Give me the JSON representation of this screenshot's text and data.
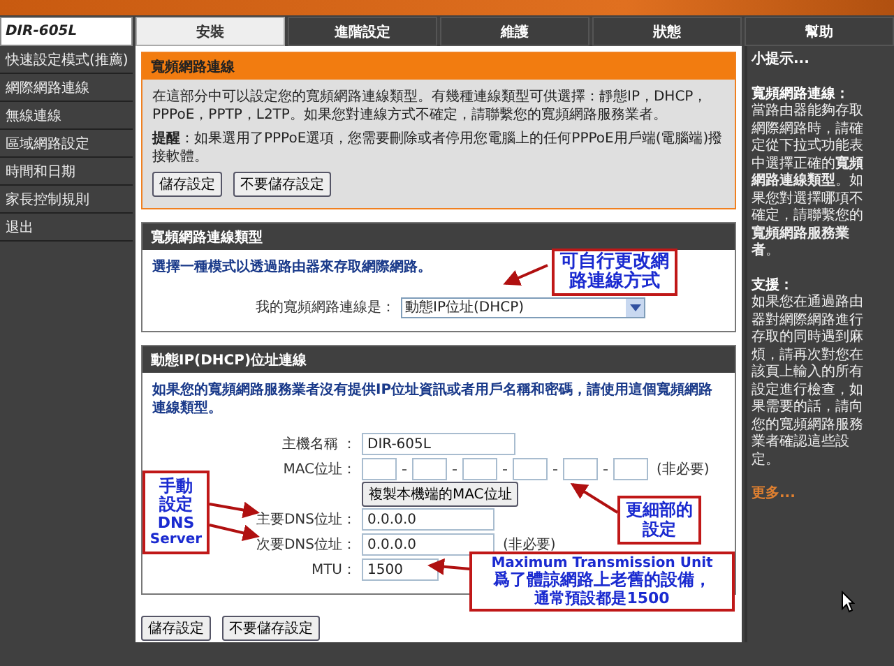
{
  "logo": "DIR-605L",
  "tabs": [
    {
      "label": "安裝",
      "selected": true
    },
    {
      "label": "進階設定",
      "selected": false
    },
    {
      "label": "維護",
      "selected": false
    },
    {
      "label": "狀態",
      "selected": false
    },
    {
      "label": "幫助",
      "selected": false
    }
  ],
  "sidebar": {
    "items": [
      {
        "label": "快速設定模式(推薦)"
      },
      {
        "label": "網際網路連線"
      },
      {
        "label": "無線連線"
      },
      {
        "label": "區域網路設定"
      },
      {
        "label": "時間和日期"
      },
      {
        "label": "家長控制規則"
      },
      {
        "label": "退出"
      }
    ]
  },
  "intro": {
    "title": "寬頻網路連線",
    "text": "在這部分中可以設定您的寬頻網路連線類型。有幾種連線類型可供選擇：靜態IP，DHCP，PPPoE，PPTP，L2TP。如果您對連線方式不確定，請聯繫您的寬頻網路服務業者。",
    "note": "**提醒**：如果選用了PPPoE選項，您需要刪除或者停用您電腦上的任何PPPoE用戶端(電腦端)撥接軟體。",
    "buttons": [
      "儲存設定",
      "不要儲存設定"
    ]
  },
  "type_section": {
    "title": "寬頻網路連線類型",
    "text": "選擇一種模式以透過路由器來存取網際網路。",
    "label": "我的寬頻網路連線是：",
    "value": "動態IP位址(DHCP)"
  },
  "dhcp_section": {
    "title": "動態IP(DHCP)位址連線",
    "text": "如果您的寬頻網路服務業者沒有提供IP位址資訊或者用戶名稱和密碼，請使用這個寬頻網路連線類型。",
    "host": {
      "label": "主機名稱 ：",
      "value": "DIR-605L"
    },
    "mac": {
      "label": "MAC位址：",
      "note": "(非必要)",
      "button": "複製本機端的MAC位址"
    },
    "dns1": {
      "label": "主要DNS位址：",
      "value": "0.0.0.0"
    },
    "dns2": {
      "label": "次要DNS位址：",
      "value": "0.0.0.0",
      "note": "(非必要)"
    },
    "mtu": {
      "label": "MTU：",
      "value": "1500"
    }
  },
  "bottom_buttons": [
    "儲存設定",
    "不要儲存設定"
  ],
  "help": {
    "title": "小提示...",
    "heading1": "寬頻網路連線：",
    "text1": "當路由器能夠存取網際網路時，請確定從下拉式功能表中選擇正確的**寬頻網路連線類型**。如果您對選擇哪項不確定，請聯繫您的**寬頻網路服務業者**。",
    "heading2": "支援：",
    "text2": "如果您在通過路由器對網際網路進行存取的同時遇到麻煩，請再次對您在該頁上輸入的所有設定進行檢查，如果需要的話，請向您的寬頻網路服務業者確認這些設定。",
    "more": "更多..."
  },
  "annotations": [
    {
      "lines": [
        "可自行更改網",
        "路連線方式"
      ]
    },
    {
      "lines": [
        "手動",
        "設定",
        "DNS",
        "Server"
      ]
    },
    {
      "lines": [
        "更細部的",
        "設定"
      ]
    },
    {
      "lines": [
        "Maximum Transmission Unit",
        "爲了體諒網路上老舊的設備，",
        "通常預設都是1500"
      ]
    }
  ]
}
